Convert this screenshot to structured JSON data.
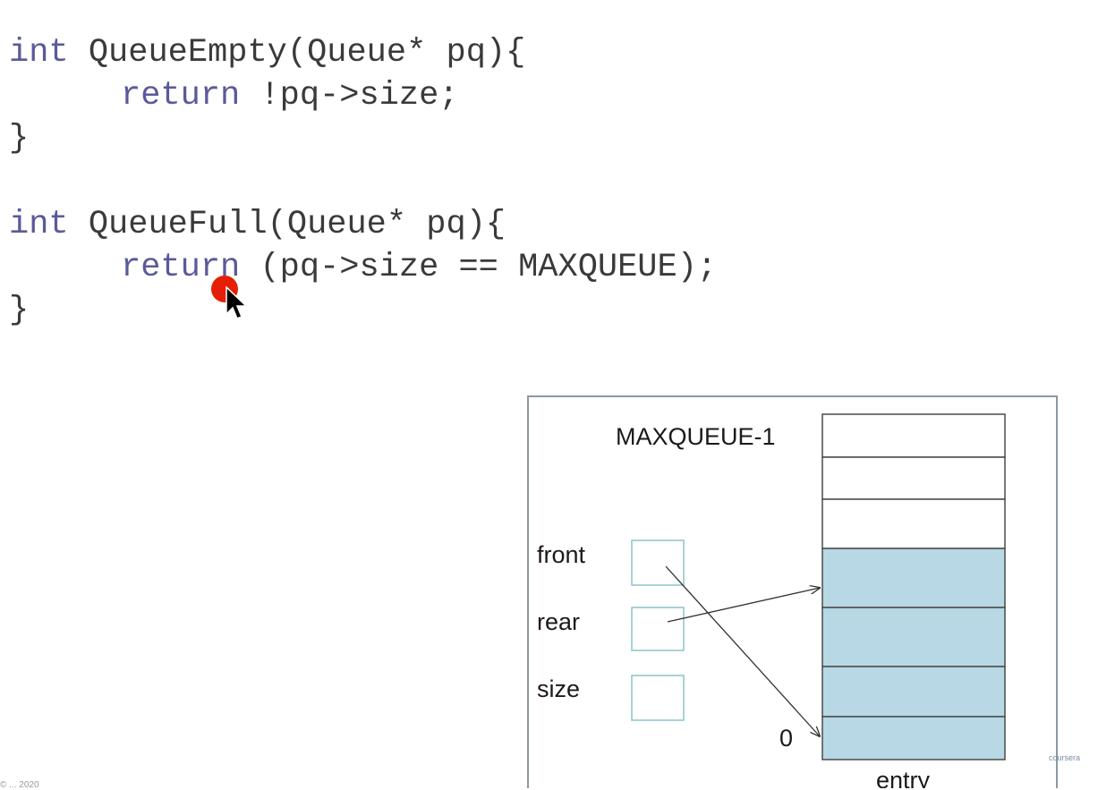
{
  "code": {
    "line1": {
      "kw": "int",
      "rest": " QueueEmpty(Queue* pq){"
    },
    "line2": {
      "kw": "return",
      "rest": " !pq->size;"
    },
    "line3": "}",
    "line5": {
      "kw": "int",
      "rest": " QueueFull(Queue* pq){"
    },
    "line6": {
      "kw": "return",
      "rest": " (pq->size == MAXQUEUE);"
    },
    "line7": "}"
  },
  "diagram": {
    "top_label": "MAXQUEUE-1",
    "fields": [
      "front",
      "rear",
      "size"
    ],
    "bottom_index_label": "0",
    "array_label": "entry",
    "filled_color": "#b7d8e4",
    "field_box_border": "#8ac4c8"
  },
  "watermark": "coursera",
  "footer_text": "© ... 2020"
}
